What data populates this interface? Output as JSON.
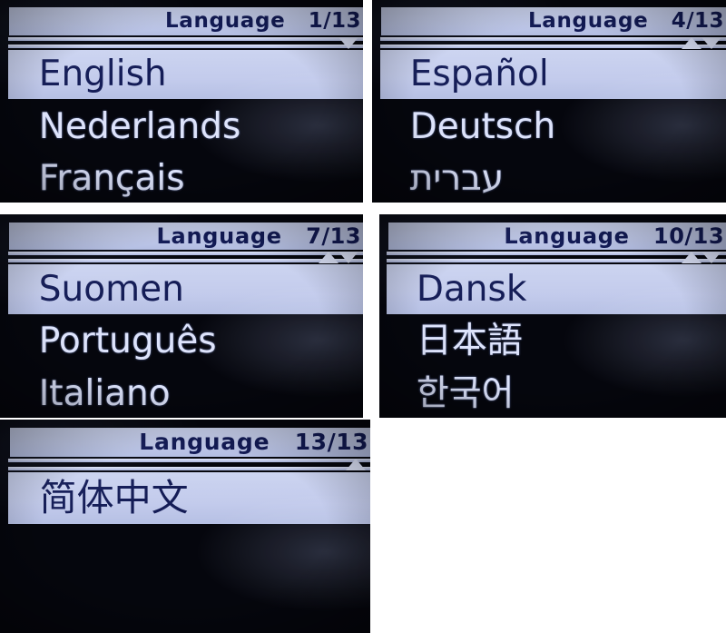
{
  "screen": {
    "title": "Language",
    "total_pages": 13,
    "colors": {
      "lcd_background": "#05060d",
      "highlight_background": "#c5cdee",
      "highlight_text": "#141c56",
      "normal_text": "#dde3fb",
      "header_background": "#c7cfee",
      "header_text": "#121a55",
      "arrow": "#dfe5fb",
      "page_background": "#ffffff"
    }
  },
  "panels": [
    {
      "id": "panel-1",
      "header_title": "Language",
      "page_counter": "1/13",
      "arrows": {
        "up": false,
        "down": true
      },
      "items": [
        {
          "label": "English",
          "selected": true
        },
        {
          "label": "Nederlands",
          "selected": false
        },
        {
          "label": "Français",
          "selected": false
        }
      ]
    },
    {
      "id": "panel-2",
      "header_title": "Language",
      "page_counter": "4/13",
      "arrows": {
        "up": true,
        "down": true
      },
      "items": [
        {
          "label": "Español",
          "selected": true
        },
        {
          "label": "Deutsch",
          "selected": false
        },
        {
          "label": "עברית",
          "selected": false,
          "rtl": true
        }
      ]
    },
    {
      "id": "panel-3",
      "header_title": "Language",
      "page_counter": "7/13",
      "arrows": {
        "up": true,
        "down": true
      },
      "items": [
        {
          "label": "Suomen",
          "selected": true
        },
        {
          "label": "Português",
          "selected": false
        },
        {
          "label": "Italiano",
          "selected": false
        }
      ]
    },
    {
      "id": "panel-4",
      "header_title": "Language",
      "page_counter": "10/13",
      "arrows": {
        "up": true,
        "down": true
      },
      "items": [
        {
          "label": "Dansk",
          "selected": true
        },
        {
          "label": "日本語",
          "selected": false
        },
        {
          "label": "한국어",
          "selected": false
        }
      ]
    },
    {
      "id": "panel-5",
      "header_title": "Language",
      "page_counter": "13/13",
      "arrows": {
        "up": true,
        "down": false
      },
      "items": [
        {
          "label": "简体中文",
          "selected": true
        }
      ]
    }
  ]
}
